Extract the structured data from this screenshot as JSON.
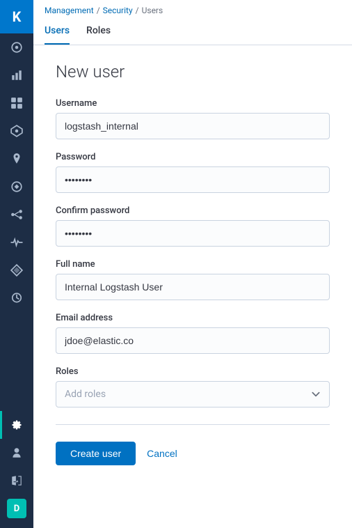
{
  "breadcrumb": {
    "management": "Management",
    "security": "Security",
    "users": "Users",
    "separator": "/"
  },
  "tabs": [
    {
      "id": "users",
      "label": "Users",
      "active": true
    },
    {
      "id": "roles",
      "label": "Roles",
      "active": false
    }
  ],
  "page": {
    "title": "New user"
  },
  "form": {
    "username_label": "Username",
    "username_value": "logstash_internal",
    "password_label": "Password",
    "password_value": "••••••••",
    "confirm_password_label": "Confirm password",
    "confirm_password_value": "••••••••",
    "fullname_label": "Full name",
    "fullname_value": "Internal Logstash User",
    "email_label": "Email address",
    "email_value": "jdoe@elastic.co",
    "roles_label": "Roles",
    "roles_placeholder": "Add roles"
  },
  "actions": {
    "create_label": "Create user",
    "cancel_label": "Cancel"
  },
  "sidebar": {
    "logo": "K",
    "icons": [
      {
        "id": "discover",
        "symbol": "◎"
      },
      {
        "id": "visualize",
        "symbol": "⬛"
      },
      {
        "id": "dashboard",
        "symbol": "🕐"
      },
      {
        "id": "canvas",
        "symbol": "◈"
      },
      {
        "id": "maps",
        "symbol": "⬡"
      },
      {
        "id": "ml",
        "symbol": "⚙"
      },
      {
        "id": "graph",
        "symbol": "⋮"
      },
      {
        "id": "monitoring",
        "symbol": "≡"
      },
      {
        "id": "apm",
        "symbol": "✳"
      },
      {
        "id": "uptime",
        "symbol": "♡"
      },
      {
        "id": "management",
        "symbol": "⚙",
        "active": true
      }
    ],
    "bottom": [
      {
        "id": "user",
        "symbol": "👤"
      },
      {
        "id": "logout",
        "symbol": "⬏"
      },
      {
        "id": "avatar",
        "symbol": "D",
        "highlight": true
      }
    ],
    "extra": [
      {
        "id": "help",
        "symbol": "?"
      }
    ]
  }
}
